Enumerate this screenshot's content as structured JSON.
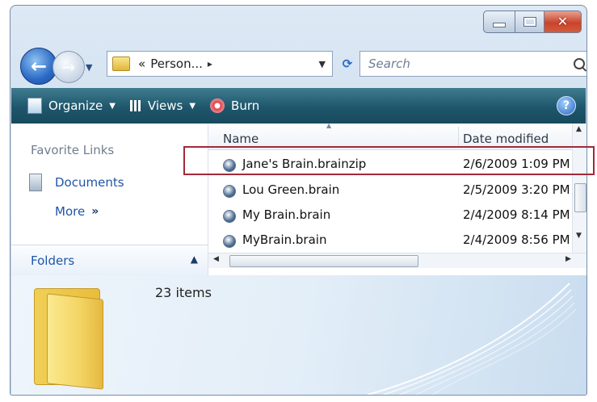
{
  "window": {
    "caption_buttons": {
      "minimize_icon": "minimize-icon",
      "maximize_icon": "maximize-icon",
      "close_glyph": "✕"
    }
  },
  "address_bar": {
    "crumb_prefix": "«",
    "crumb_text": "Person...",
    "crumb_separator": "▸",
    "search_placeholder": "Search"
  },
  "toolbar": {
    "organize_label": "Organize",
    "views_label": "Views",
    "burn_label": "Burn",
    "help_glyph": "?"
  },
  "nav_pane": {
    "favorite_links_title": "Favorite Links",
    "documents_label": "Documents",
    "more_label": "More",
    "more_chevron": "»",
    "folders_label": "Folders"
  },
  "file_list": {
    "columns": [
      "Name",
      "Date modified"
    ],
    "rows": [
      {
        "name": "Jane's Brain.brainzip",
        "date": "2/6/2009 1:09 PM"
      },
      {
        "name": "Lou Green.brain",
        "date": "2/5/2009 3:20 PM"
      },
      {
        "name": "My Brain.brain",
        "date": "2/4/2009 8:14 PM"
      },
      {
        "name": "MyBrain.brain",
        "date": "2/4/2009 8:56 PM"
      }
    ]
  },
  "details": {
    "items_count": "23 items"
  },
  "colors": {
    "toolbar": "#1f566b",
    "link": "#1e55a8",
    "highlight_box": "#a22a3a",
    "close_button": "#c8442c"
  }
}
